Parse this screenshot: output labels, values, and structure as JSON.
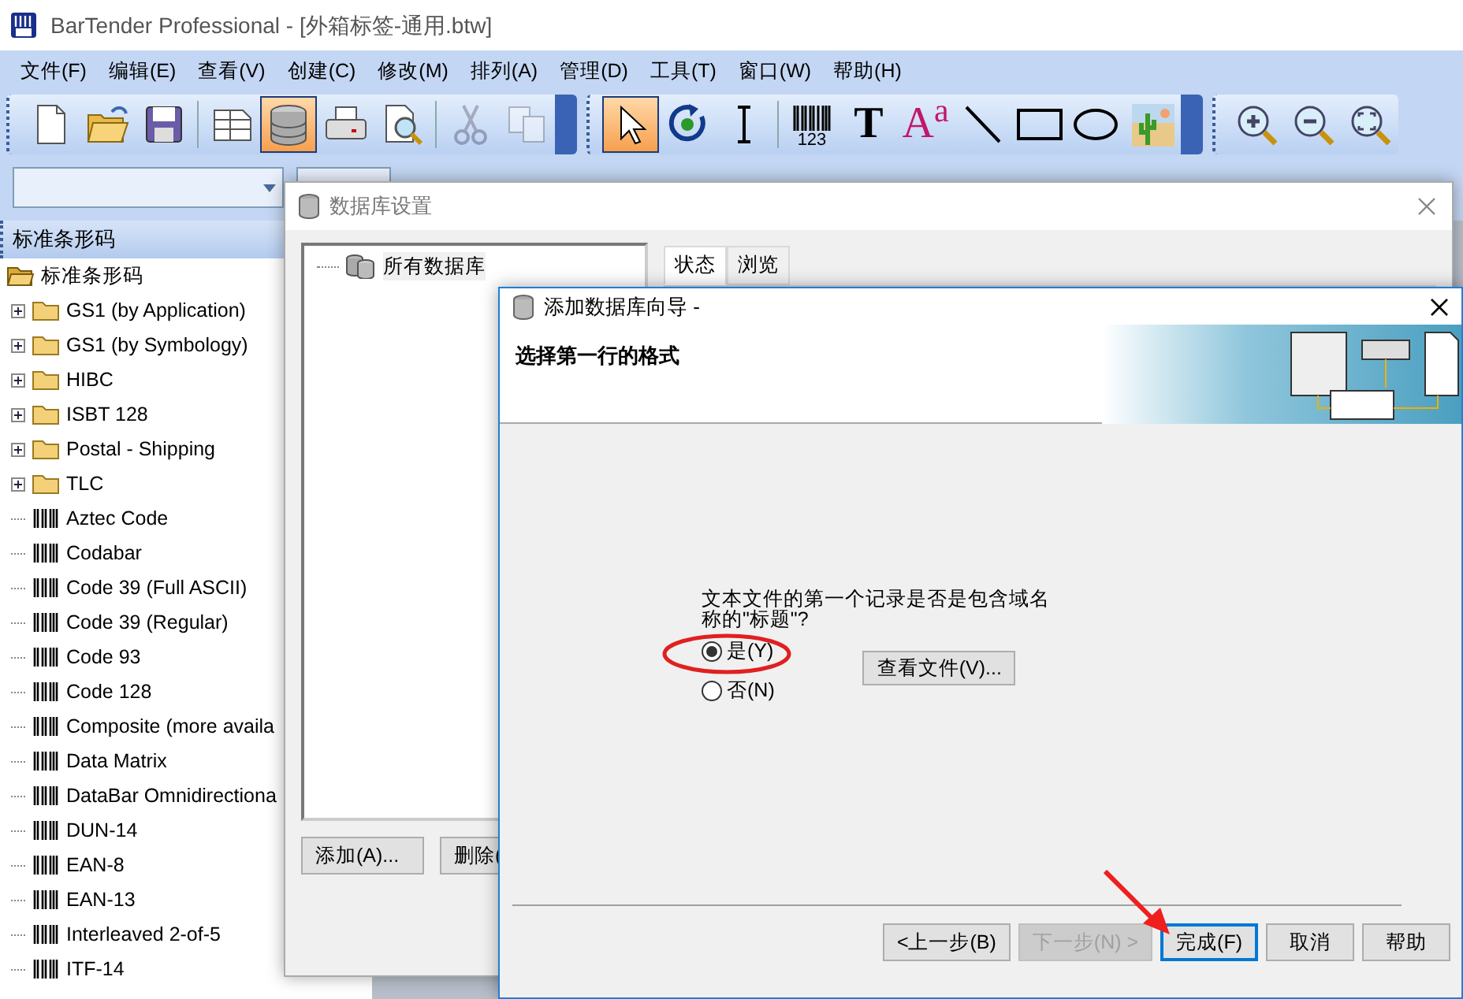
{
  "window": {
    "title": "BarTender Professional - [外箱标签-通用.btw]"
  },
  "menu": [
    "文件(F)",
    "编辑(E)",
    "查看(V)",
    "创建(C)",
    "修改(M)",
    "排列(A)",
    "管理(D)",
    "工具(T)",
    "窗口(W)",
    "帮助(H)"
  ],
  "toolbars": [
    {
      "items": [
        {
          "kind": "new",
          "selected": false,
          "disabled": false
        },
        {
          "kind": "open",
          "selected": false,
          "disabled": false
        },
        {
          "kind": "save",
          "selected": false,
          "disabled": false
        },
        {
          "kind": "sep"
        },
        {
          "kind": "table",
          "selected": false,
          "disabled": false
        },
        {
          "kind": "database",
          "selected": true,
          "disabled": false
        },
        {
          "kind": "print",
          "selected": false,
          "disabled": false
        },
        {
          "kind": "preview",
          "selected": false,
          "disabled": false
        },
        {
          "kind": "sep"
        },
        {
          "kind": "cut",
          "selected": false,
          "disabled": true
        },
        {
          "kind": "copy",
          "selected": false,
          "disabled": true
        }
      ]
    },
    {
      "items": [
        {
          "kind": "pointer",
          "selected": true,
          "disabled": false
        },
        {
          "kind": "rotate",
          "selected": false,
          "disabled": false
        },
        {
          "kind": "ibeam",
          "selected": false,
          "disabled": false
        },
        {
          "kind": "sep"
        },
        {
          "kind": "barcode",
          "glyph": "123",
          "selected": false,
          "disabled": false
        },
        {
          "kind": "text",
          "glyph": "T",
          "selected": false,
          "disabled": false
        },
        {
          "kind": "richtext",
          "glyph": "A$^{a}$",
          "selected": false,
          "disabled": false
        },
        {
          "kind": "line",
          "selected": false,
          "disabled": false
        },
        {
          "kind": "rectangle",
          "selected": false,
          "disabled": false
        },
        {
          "kind": "ellipse",
          "selected": false,
          "disabled": false
        },
        {
          "kind": "picture",
          "selected": false,
          "disabled": false
        }
      ]
    },
    {
      "items": [
        {
          "kind": "zoomin",
          "selected": false,
          "disabled": false
        },
        {
          "kind": "zoomout",
          "selected": false,
          "disabled": false
        },
        {
          "kind": "zoomfit",
          "selected": false,
          "disabled": false
        }
      ]
    }
  ],
  "panel": {
    "title": "标准条形码",
    "root": {
      "label": "标准条形码",
      "children": [
        {
          "label": "GS1 (by Application)",
          "kind": "folder",
          "expanded": false
        },
        {
          "label": "GS1 (by Symbology)",
          "kind": "folder",
          "expanded": false
        },
        {
          "label": "HIBC",
          "kind": "folder",
          "expanded": false
        },
        {
          "label": "ISBT 128",
          "kind": "folder",
          "expanded": false
        },
        {
          "label": "Postal - Shipping",
          "kind": "folder",
          "expanded": false
        },
        {
          "label": "TLC",
          "kind": "folder",
          "expanded": false
        },
        {
          "label": "Aztec Code",
          "kind": "barcode"
        },
        {
          "label": "Codabar",
          "kind": "barcode"
        },
        {
          "label": "Code 39 (Full ASCII)",
          "kind": "barcode"
        },
        {
          "label": "Code 39 (Regular)",
          "kind": "barcode"
        },
        {
          "label": "Code 93",
          "kind": "barcode"
        },
        {
          "label": "Code 128",
          "kind": "barcode"
        },
        {
          "label": "Composite (more availa",
          "kind": "barcode"
        },
        {
          "label": "Data Matrix",
          "kind": "barcode"
        },
        {
          "label": "DataBar Omnidirectiona",
          "kind": "barcode"
        },
        {
          "label": "DUN-14",
          "kind": "barcode"
        },
        {
          "label": "EAN-8",
          "kind": "barcode"
        },
        {
          "label": "EAN-13",
          "kind": "barcode"
        },
        {
          "label": "Interleaved 2-of-5",
          "kind": "barcode"
        },
        {
          "label": "ITF-14",
          "kind": "barcode"
        }
      ]
    }
  },
  "db_dialog": {
    "title": "数据库设置",
    "tree": [
      {
        "label": "所有数据库"
      }
    ],
    "tabs": [
      {
        "label": "状态",
        "selected": true
      },
      {
        "label": "浏览",
        "selected": false
      }
    ],
    "buttons": [
      "添加(A)...",
      "删除("
    ]
  },
  "wizard": {
    "title": "添加数据库向导 -",
    "heading": "选择第一行的格式",
    "question": "文本文件的第一个记录是否是包含域名称的\"标题\"?",
    "options": [
      {
        "label": "是(Y)",
        "selected": true
      },
      {
        "label": "否(N)",
        "selected": false
      }
    ],
    "view_button": "查看文件(V)...",
    "buttons": [
      {
        "label": "<上一步(B)",
        "disabled": false,
        "default": false
      },
      {
        "label": "下一步(N) >",
        "disabled": true,
        "default": false
      },
      {
        "label": "完成(F)",
        "disabled": false,
        "default": true
      },
      {
        "label": "取消",
        "disabled": false,
        "default": false
      },
      {
        "label": "帮助",
        "disabled": false,
        "default": false
      }
    ]
  }
}
